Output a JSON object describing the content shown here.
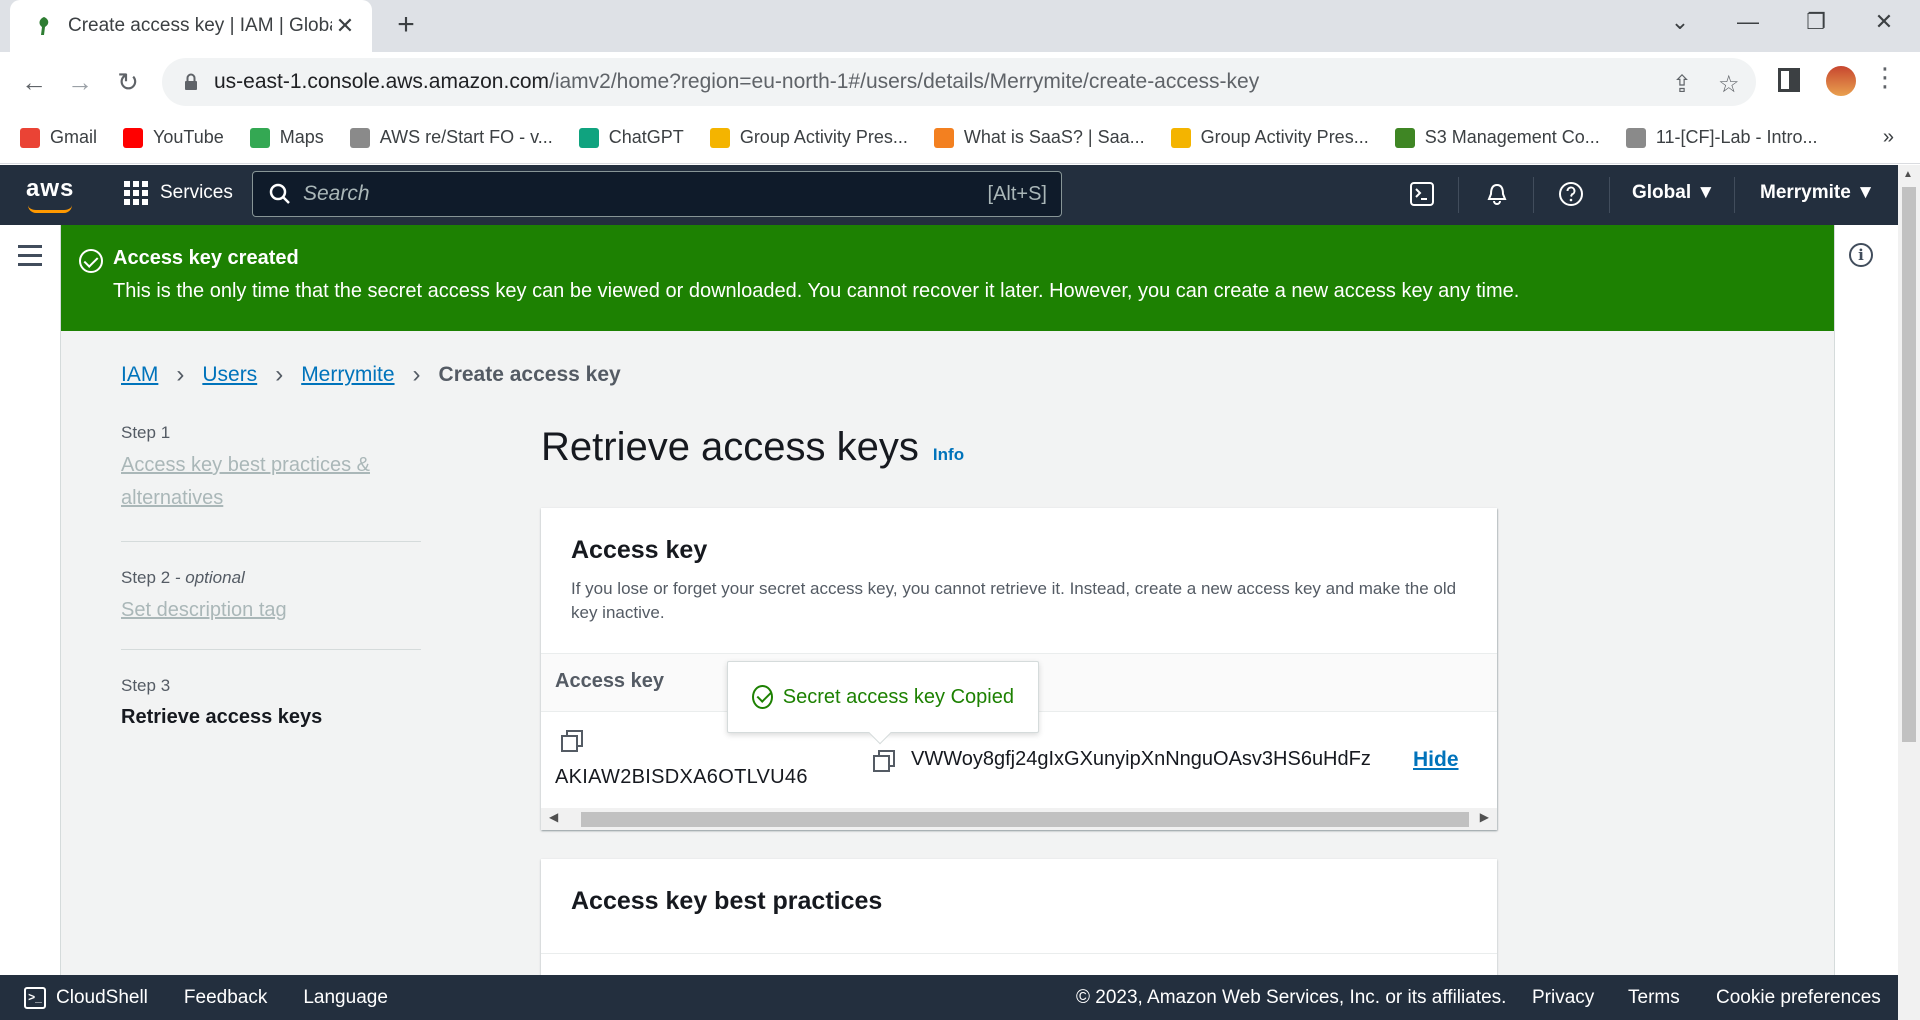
{
  "browser": {
    "tab_title": "Create access key | IAM | Global",
    "url_host": "us-east-1.console.aws.amazon.com",
    "url_path": "/iamv2/home?region=eu-north-1#/users/details/Merrymite/create-access-key",
    "bookmarks": [
      {
        "label": "Gmail",
        "icon": "gmail-icon",
        "color": "#ea4335"
      },
      {
        "label": "YouTube",
        "icon": "youtube-icon",
        "color": "#ff0000"
      },
      {
        "label": "Maps",
        "icon": "maps-icon",
        "color": "#34a853"
      },
      {
        "label": "AWS re/Start FO - v...",
        "icon": "aws-restart-icon",
        "color": "#8a8a8a"
      },
      {
        "label": "ChatGPT",
        "icon": "chatgpt-icon",
        "color": "#10a37f"
      },
      {
        "label": "Group Activity Pres...",
        "icon": "slides-icon",
        "color": "#f4b400"
      },
      {
        "label": "What is SaaS? | Saa...",
        "icon": "cloudflare-icon",
        "color": "#f38020"
      },
      {
        "label": "Group Activity Pres...",
        "icon": "slides-icon",
        "color": "#f4b400"
      },
      {
        "label": "S3 Management Co...",
        "icon": "s3-icon",
        "color": "#3f8624"
      },
      {
        "label": "11-[CF]-Lab - Intro...",
        "icon": "lab-icon",
        "color": "#8a8a8a"
      }
    ],
    "bookmarks_more": "»"
  },
  "aws_nav": {
    "logo": "aws",
    "services_label": "Services",
    "search_placeholder": "Search",
    "search_shortcut": "[Alt+S]",
    "region_label": "Global",
    "account_label": "Merrymite"
  },
  "flash": {
    "title": "Access key created",
    "body": "This is the only time that the secret access key can be viewed or downloaded. You cannot recover it later. However, you can create a new access key any time.",
    "color": "#1d8102"
  },
  "breadcrumb": {
    "items": [
      "IAM",
      "Users",
      "Merrymite"
    ],
    "current": "Create access key"
  },
  "steps": [
    {
      "label": "Step 1",
      "title": "Access key best practices & alternatives"
    },
    {
      "label": "Step 2",
      "optional": "- optional",
      "title": "Set description tag"
    },
    {
      "label": "Step 3",
      "title": "Retrieve access keys"
    }
  ],
  "page": {
    "heading": "Retrieve access keys",
    "info_link": "Info"
  },
  "access_key_card": {
    "title": "Access key",
    "description": "If you lose or forget your secret access key, you cannot retrieve it. Instead, create a new access key and make the old key inactive.",
    "column_header": "Access key",
    "access_key_id": "AKIAW2BISDXA6OTLVU46",
    "secret_access_key": "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",
    "hide_label": "Hide",
    "tooltip": "Secret access key Copied"
  },
  "best_practices_card": {
    "title": "Access key best practices"
  },
  "footer": {
    "cloudshell": "CloudShell",
    "feedback": "Feedback",
    "language": "Language",
    "copyright": "© 2023, Amazon Web Services, Inc. or its affiliates.",
    "privacy": "Privacy",
    "terms": "Terms",
    "cookie": "Cookie preferences"
  }
}
